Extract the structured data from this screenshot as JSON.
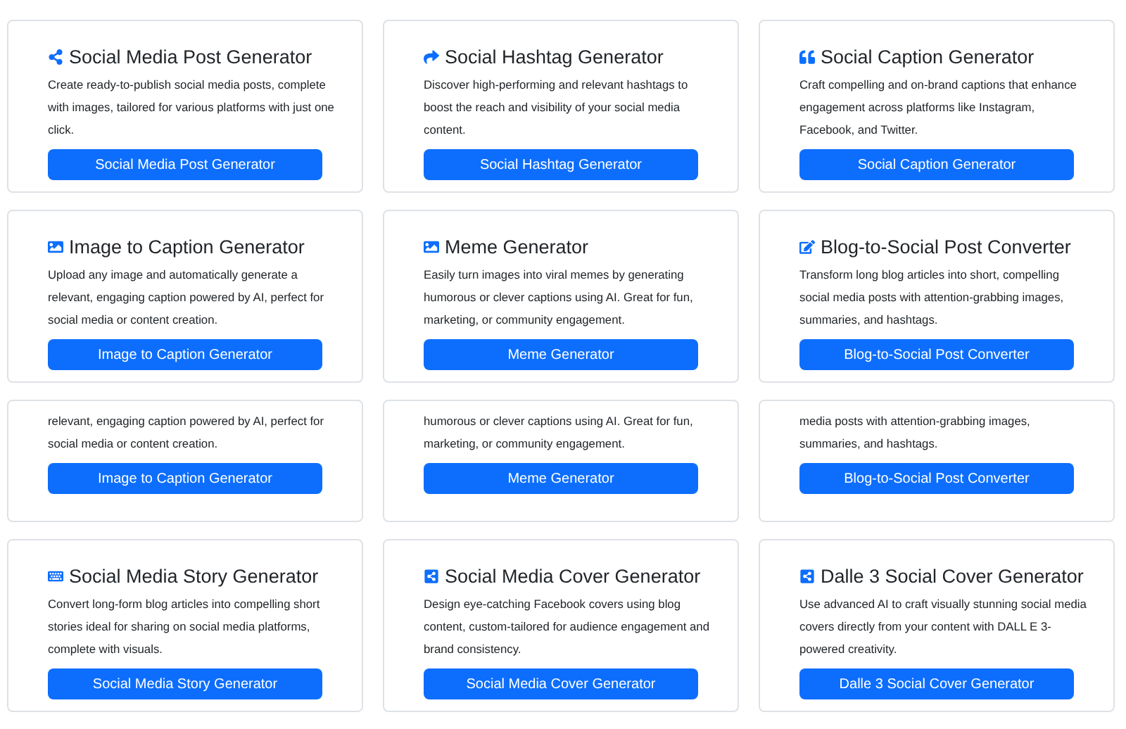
{
  "cards": [
    {
      "title": "Social Media Post Generator",
      "description": "Create ready-to-publish social media posts, complete with images, tailored for various platforms with just one click.",
      "button": "Social Media Post Generator"
    },
    {
      "title": "Social Hashtag Generator",
      "description": "Discover high-performing and relevant hashtags to boost the reach and visibility of your social media content.",
      "button": "Social Hashtag Generator"
    },
    {
      "title": "Social Caption Generator",
      "description": "Craft compelling and on-brand captions that enhance engagement across platforms like Instagram, Facebook, and Twitter.",
      "button": "Social Caption Generator"
    },
    {
      "title": "Image to Caption Generator",
      "description": "Upload any image and automatically generate a relevant, engaging caption powered by AI, perfect for social media or content creation.",
      "button": "Image to Caption Generator"
    },
    {
      "title": "Meme Generator",
      "description": "Easily turn images into viral memes by generating humorous or clever captions using AI. Great for fun, marketing, or community engagement.",
      "button": "Meme Generator"
    },
    {
      "title": "Blog-to-Social Post Converter",
      "description": "Transform long blog articles into short, compelling social media posts with attention-grabbing images, summaries, and hashtags.",
      "button": "Blog-to-Social Post Converter"
    },
    {
      "kind": "cut",
      "description": "relevant, engaging caption powered by AI, perfect for social media or content creation.",
      "button": "Image to Caption Generator"
    },
    {
      "kind": "cut",
      "description": "humorous or clever captions using AI. Great for fun, marketing, or community engagement.",
      "button": "Meme Generator"
    },
    {
      "kind": "cut",
      "description": "media posts with attention-grabbing images, summaries, and hashtags.",
      "button": "Blog-to-Social Post Converter"
    },
    {
      "title": "Social Media Story Generator",
      "description": "Convert long-form blog articles into compelling short stories ideal for sharing on social media platforms, complete with visuals.",
      "button": "Social Media Story Generator"
    },
    {
      "title": "Social Media Cover Generator",
      "description": "Design eye-catching Facebook covers using blog content, custom-tailored for audience engagement and brand consistency.",
      "button": "Social Media Cover Generator"
    },
    {
      "title": "Dalle 3 Social Cover Generator",
      "description": "Use advanced AI to craft visually stunning social media covers directly from your content with DALL E 3-powered creativity.",
      "button": "Dalle 3 Social Cover Generator"
    }
  ]
}
